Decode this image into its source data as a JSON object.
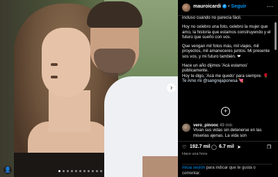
{
  "post": {
    "handle": "mauroicardi",
    "follow_label": "Seguir",
    "separator": "•",
    "more_label": "···",
    "caption": [
      "incluso cuando no parecía fácil.",
      "Hoy no celebro una foto, celebro la mujer que amo, la historia que estamos construyendo y el futuro que sueño con vos.",
      "Que vengan mil fotos más, mil viajes, mil proyectos, mil amaneceres juntos. Mi presente sos vos, y mi futuro también. ❤",
      "Hace un año dijimos 'Acá estamos' públicamente.",
      "Hoy te digo, 'Acá me quedo' para siempre. 🌹",
      "Te Amo mi @sangrejaponesa 💘"
    ]
  },
  "comment": {
    "user": "vero_pinooc",
    "time": "49 min",
    "text": "Vivan sus vidas sin detenerse en las miserias ajenas. La vida son"
  },
  "actions": {
    "likes": "192.7 mil",
    "comments": "6.7 mil",
    "heart_icon": "♡",
    "comment_icon": "◯",
    "share_icon": "➤",
    "save_icon": "❒"
  },
  "date": "Hace una hora",
  "login": {
    "link": "Inicia sesión",
    "rest": " para indicar que te gusta o comentar."
  },
  "carousel": {
    "next_icon": "›",
    "dots_total": 12,
    "active_index": 0
  },
  "user_badge_icon": "👤"
}
